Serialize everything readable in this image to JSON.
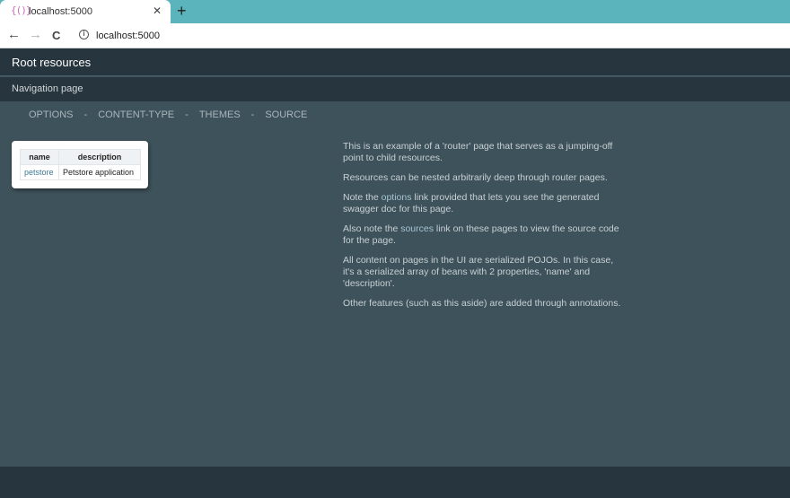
{
  "browser": {
    "tab_favicon": "{()}",
    "tab_title": "localhost:5000",
    "tab_close": "✕",
    "new_tab": "+",
    "back": "←",
    "forward": "→",
    "reload": "C",
    "info": "i",
    "url": "localhost:5000"
  },
  "page": {
    "title": "Root resources",
    "subtitle": "Navigation page",
    "nav": [
      {
        "label": "OPTIONS"
      },
      {
        "label": "CONTENT-TYPE"
      },
      {
        "label": "THEMES"
      },
      {
        "label": "SOURCE"
      }
    ],
    "nav_separator": "-",
    "table": {
      "headers": [
        "name",
        "description"
      ],
      "rows": [
        {
          "name": "petstore",
          "description": "Petstore application"
        }
      ]
    },
    "aside": {
      "p1": "This is an example of a 'router' page that serves as a jumping-off point to child resources.",
      "p2": "Resources can be nested arbitrarily deep through router pages.",
      "p3_pre": "Note the ",
      "p3_link": "options",
      "p3_post": " link provided that lets you see the generated swagger doc for this page.",
      "p4_pre": "Also note the ",
      "p4_link": "sources",
      "p4_post": " link on these pages to view the source code for the page.",
      "p5": "All content on pages in the UI are serialized POJOs. In this case, it's a serialized array of beans with 2 properties, 'name' and 'description'.",
      "p6": "Other features (such as this aside) are added through annotations."
    }
  }
}
